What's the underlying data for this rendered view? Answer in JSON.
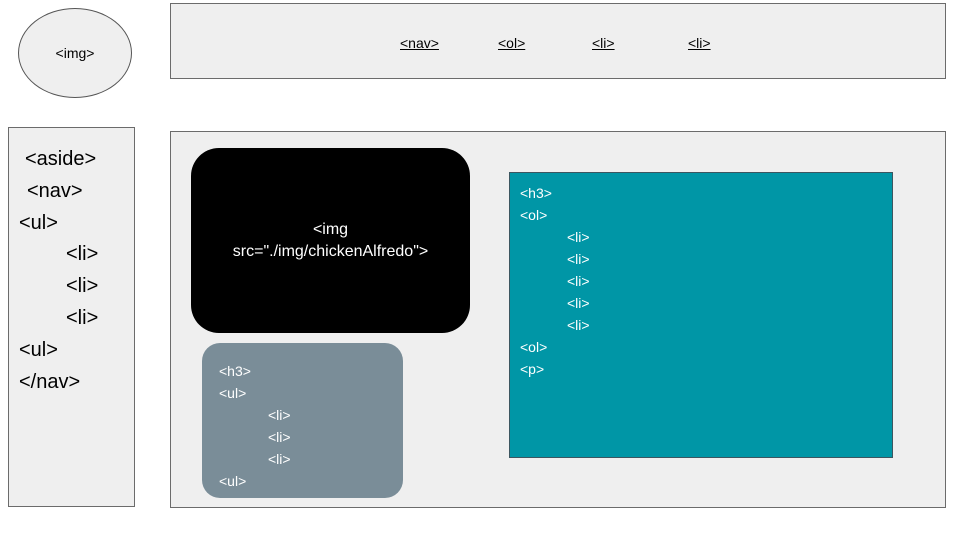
{
  "logo": {
    "label": "<img>"
  },
  "top_nav": {
    "items": [
      "<nav>",
      "<ol>",
      "<li>",
      "<li>"
    ]
  },
  "aside": {
    "lines": [
      "<aside>",
      "<nav>",
      "<ul>",
      "<li>",
      "<li>",
      "<li>",
      "<ul>",
      "</nav>"
    ]
  },
  "image_box": {
    "line1": "<img",
    "line2": "src=\"./img/chickenAlfredo\">"
  },
  "card": {
    "lines": [
      "<h3>",
      "<ul>",
      "<li>",
      "<li>",
      "<li>",
      "<ul>"
    ]
  },
  "teal_panel": {
    "lines": [
      "<h3>",
      "<ol>",
      "<li>",
      "<li>",
      "<li>",
      "<li>",
      "<li>",
      "<ol>",
      "<p>"
    ]
  },
  "colors": {
    "box_fill": "#efefef",
    "image_fill": "#000000",
    "card_fill": "#7a8d98",
    "teal_fill": "#0096a6"
  }
}
